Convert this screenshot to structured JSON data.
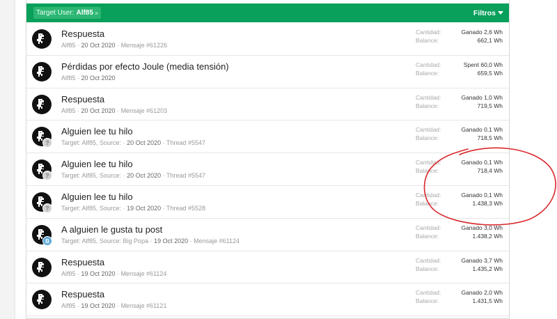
{
  "filter": {
    "chip_label": "Target User:",
    "chip_user": "Alf85",
    "chip_close": "×",
    "filters_label": "Filtros"
  },
  "labels": {
    "amount": "Cantidad:",
    "balance": "Balance:"
  },
  "rows": [
    {
      "title": "Respuesta",
      "meta": [
        "Alf85",
        "20 Oct 2020",
        "Mensaje #61226"
      ],
      "badge": "",
      "amount": "Ganado 2,6 Wh",
      "balance": "662,1 Wh"
    },
    {
      "title": "Pérdidas por efecto Joule (media tensión)",
      "meta": [
        "Alf85",
        "20 Oct 2020"
      ],
      "badge": "",
      "amount": "Spent 60,0 Wh",
      "balance": "659,5 Wh"
    },
    {
      "title": "Respuesta",
      "meta": [
        "Alf85",
        "20 Oct 2020",
        "Mensaje #61203"
      ],
      "badge": "",
      "amount": "Ganado 1,0 Wh",
      "balance": "719,5 Wh"
    },
    {
      "title": "Alguien lee tu hilo",
      "meta": [
        "Target: Alf85, Source:",
        "20 Oct 2020",
        "Thread #5547"
      ],
      "badge": "?",
      "amount": "Ganado 0,1 Wh",
      "balance": "718,5 Wh"
    },
    {
      "title": "Alguien lee tu hilo",
      "meta": [
        "Target: Alf85, Source:",
        "20 Oct 2020",
        "Thread #5547"
      ],
      "badge": "?",
      "amount": "Ganado 0,1 Wh",
      "balance": "718,4 Wh"
    },
    {
      "title": "Alguien lee tu hilo",
      "meta": [
        "Target: Alf85, Source:",
        "19 Oct 2020",
        "Thread #5528"
      ],
      "badge": "?",
      "amount": "Ganado 0,1 Wh",
      "balance": "1.438,3 Wh"
    },
    {
      "title": "A alguien le gusta tu post",
      "meta": [
        "Target: Alf85, Source: Big Popa",
        "19 Oct 2020",
        "Mensaje #61124"
      ],
      "badge": "B",
      "amount": "Ganado 3,0 Wh",
      "balance": "1.438,2 Wh"
    },
    {
      "title": "Respuesta",
      "meta": [
        "Alf85",
        "19 Oct 2020",
        "Mensaje #61124"
      ],
      "badge": "",
      "amount": "Ganado 3,7 Wh",
      "balance": "1.435,2 Wh"
    },
    {
      "title": "Respuesta",
      "meta": [
        "Alf85",
        "19 Oct 2020",
        "Mensaje #61121"
      ],
      "badge": "",
      "amount": "Ganado 2,0 Wh",
      "balance": "1.431,5 Wh"
    }
  ],
  "colors": {
    "accent": "#08a05a",
    "annotation": "#d9262a"
  }
}
